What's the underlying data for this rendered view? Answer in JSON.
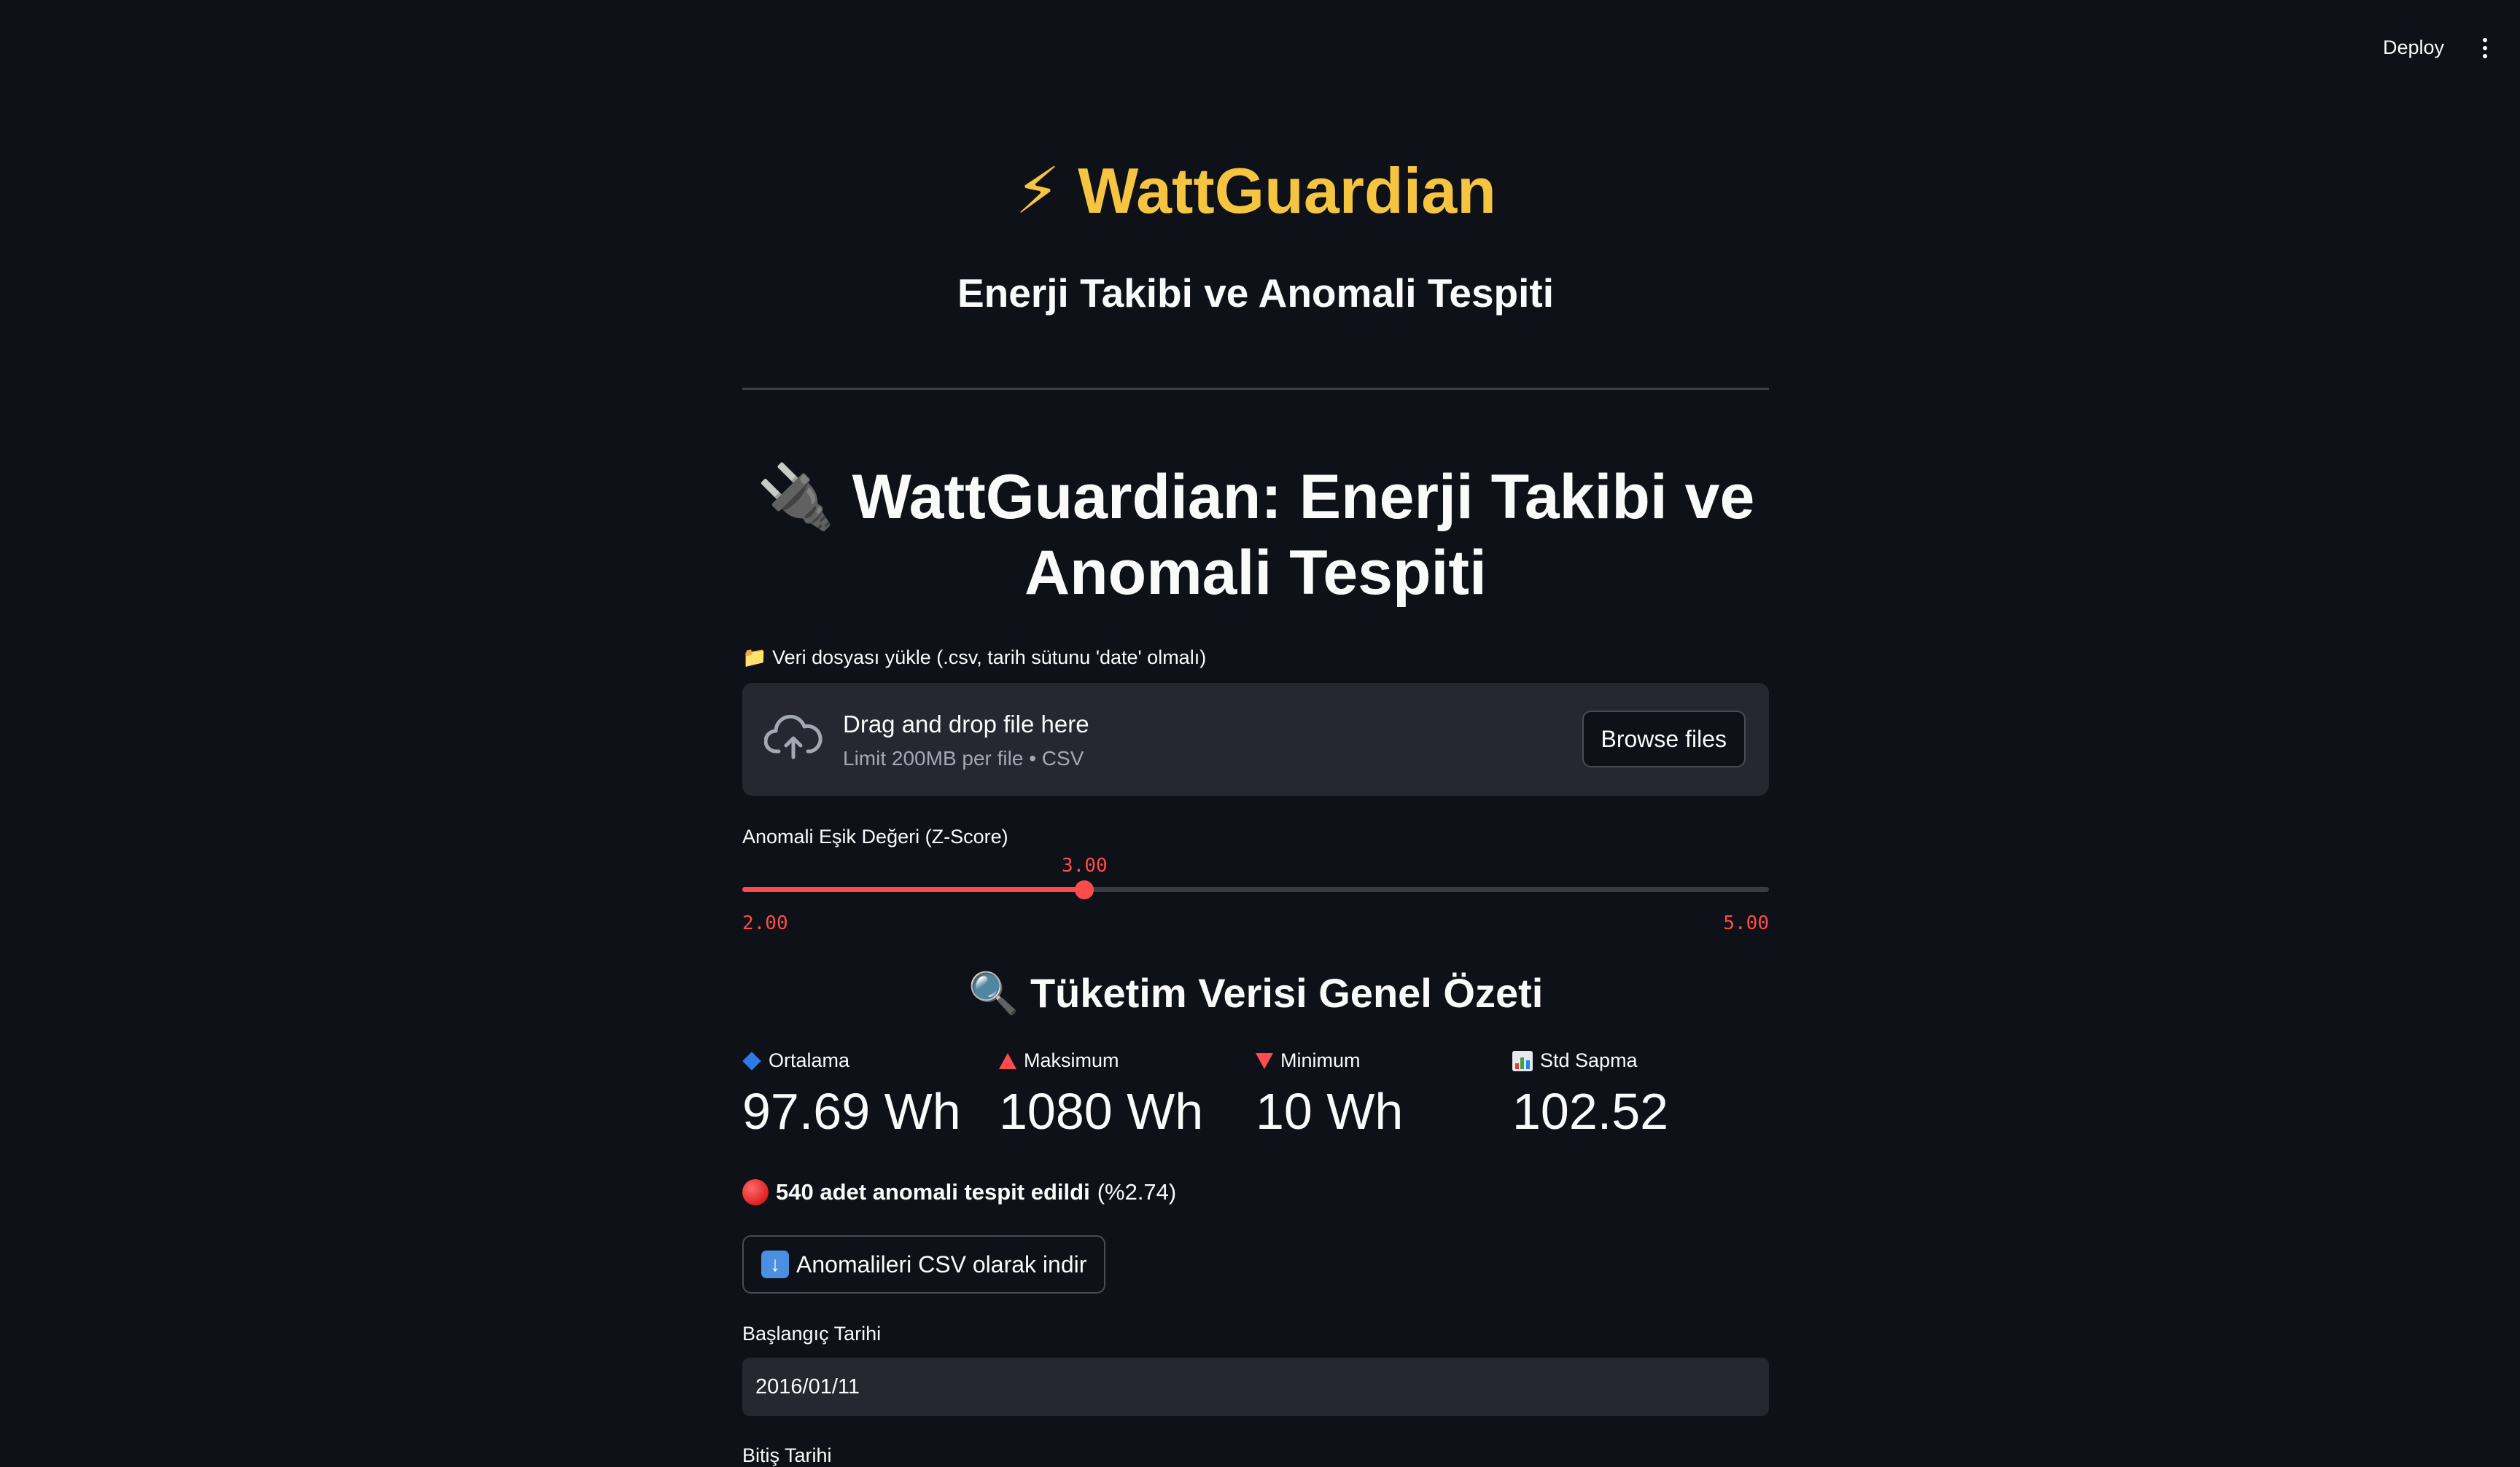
{
  "topbar": {
    "deploy_label": "Deploy"
  },
  "header": {
    "title": "⚡ WattGuardian",
    "subtitle": "Enerji Takibi ve Anomali Tespiti",
    "title_color": "#f5c542"
  },
  "main": {
    "heading": "🔌 WattGuardian: Enerji Takibi ve Anomali Tespiti"
  },
  "uploader": {
    "label": "📁 Veri dosyası yükle (.csv, tarih sütunu 'date' olmalı)",
    "drag_text": "Drag and drop file here",
    "limit_text": "Limit 200MB per file • CSV",
    "browse_label": "Browse files"
  },
  "slider": {
    "label": "Anomali Eşik Değeri (Z-Score)",
    "value": 3.0,
    "value_label": "3.00",
    "min": 2.0,
    "max": 5.0,
    "min_label": "2.00",
    "max_label": "5.00",
    "accent_color": "#ff4b4b"
  },
  "summary": {
    "heading": "🔍 Tüketim Verisi Genel Özeti",
    "metrics": [
      {
        "label": "Ortalama",
        "value": "97.69 Wh",
        "icon": "blue-diamond-icon"
      },
      {
        "label": "Maksimum",
        "value": "1080 Wh",
        "icon": "red-triangle-up-icon"
      },
      {
        "label": "Minimum",
        "value": "10 Wh",
        "icon": "red-triangle-down-icon"
      },
      {
        "label": "Std Sapma",
        "value": "102.52",
        "icon": "bar-chart-icon"
      }
    ]
  },
  "anomaly": {
    "count_text": "540 adet anomali tespit edildi",
    "percent_text": "(%2.74)"
  },
  "download": {
    "label": "Anomalileri CSV olarak indir"
  },
  "dates": {
    "start_label": "Başlangıç Tarihi",
    "start_value": "2016/01/11",
    "end_label": "Bitiş Tarihi"
  }
}
